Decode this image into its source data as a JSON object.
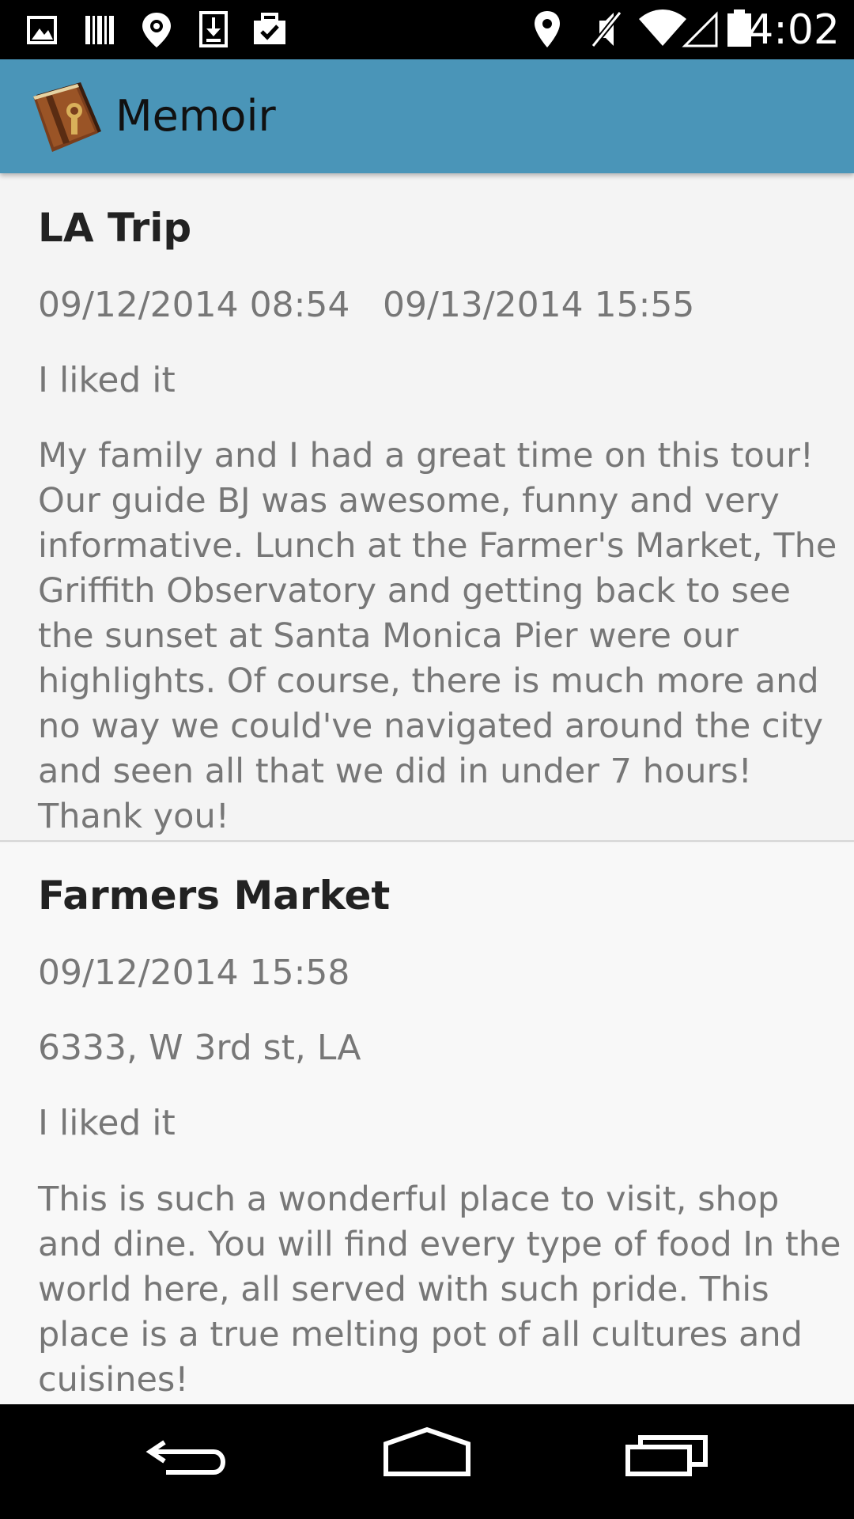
{
  "status_bar": {
    "time": "4:02",
    "left_icons": [
      "image-icon",
      "barcode-icon",
      "location-pin-outline-icon",
      "download-icon",
      "briefcase-check-icon"
    ],
    "right_icons": [
      "location-pin-icon",
      "mute-icon",
      "wifi-icon",
      "signal-icon",
      "battery-icon"
    ]
  },
  "action_bar": {
    "title": "Memoir",
    "color": "#4a95b8"
  },
  "entries": [
    {
      "title": "LA Trip",
      "start_date": "09/12/2014 08:54",
      "end_date": "09/13/2014 15:55",
      "rating": "I liked it",
      "body": "My family and I had a great time on this tour! Our guide BJ was awesome, funny and very informative. Lunch at the Farmer's Market, The Griffith Observatory and getting back to see the sunset at Santa Monica Pier were our highlights. Of course, there is much more and no way we could've navigated around the city and seen all that we did in under 7 hours! Thank you!"
    },
    {
      "title": "Farmers Market",
      "date": "09/12/2014 15:58",
      "address": "6333, W 3rd st, LA",
      "rating": "I liked it",
      "body": "This is such a wonderful place to visit, shop and dine.  You will find every type of food In the world here, all served with such pride.  This place is a true melting pot of all cultures and cuisines!"
    }
  ],
  "nav_bar": {
    "buttons": [
      "back-icon",
      "home-icon",
      "recents-icon"
    ]
  }
}
